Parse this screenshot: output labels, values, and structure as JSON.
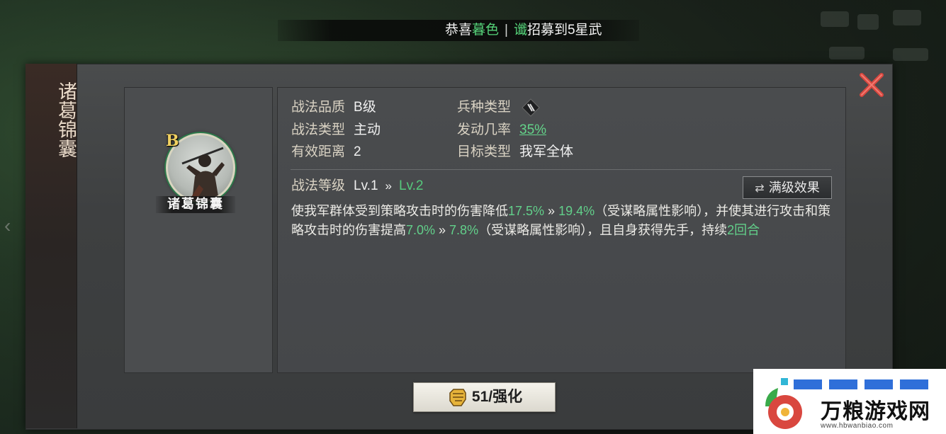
{
  "ticker": {
    "part1": "恭喜",
    "name": "暮色",
    "separator": "|",
    "prefix": "谶",
    "part2": "招募到5星武"
  },
  "skill": {
    "vertical_title": "诸葛锦囊",
    "grade": "B",
    "name_banner": "诸葛锦囊"
  },
  "info": {
    "quality_label": "战法品质",
    "quality_value": "B级",
    "troop_label": "兵种类型",
    "type_label": "战法类型",
    "type_value": "主动",
    "rate_label": "发动几率",
    "rate_value": "35%",
    "range_label": "有效距离",
    "range_value": "2",
    "target_label": "目标类型",
    "target_value": "我军全体",
    "level_label": "战法等级",
    "level_current": "Lv.1",
    "level_arrow": "»",
    "level_next": "Lv.2",
    "full_effect_button": "满级效果"
  },
  "description": {
    "t1": "使我军群体受到策略攻击时的伤害降低",
    "v1": "17.5%",
    "a1": " » ",
    "v2": "19.4%",
    "t2": "（受谋略属性影响），并使其进行攻击和策略攻击时的伤害提高",
    "v3": "7.0%",
    "a2": " » ",
    "v4": "7.8%",
    "t3": "（受谋略属性影响），且自身获得先手，持续",
    "v5": "2回合"
  },
  "upgrade": {
    "label": "51/强化"
  },
  "watermark": {
    "text": "万粮游戏网",
    "url": "www.hbwanbiao.com"
  },
  "colors": {
    "accent_green": "#56c97c",
    "close_red": "#d9473f",
    "panel": "#45474a"
  },
  "icons": {
    "close": "close-icon",
    "troop": "troop-type-icon",
    "swap": "swap-arrows-icon",
    "fist": "fist-icon",
    "back": "chevron-left-icon"
  }
}
